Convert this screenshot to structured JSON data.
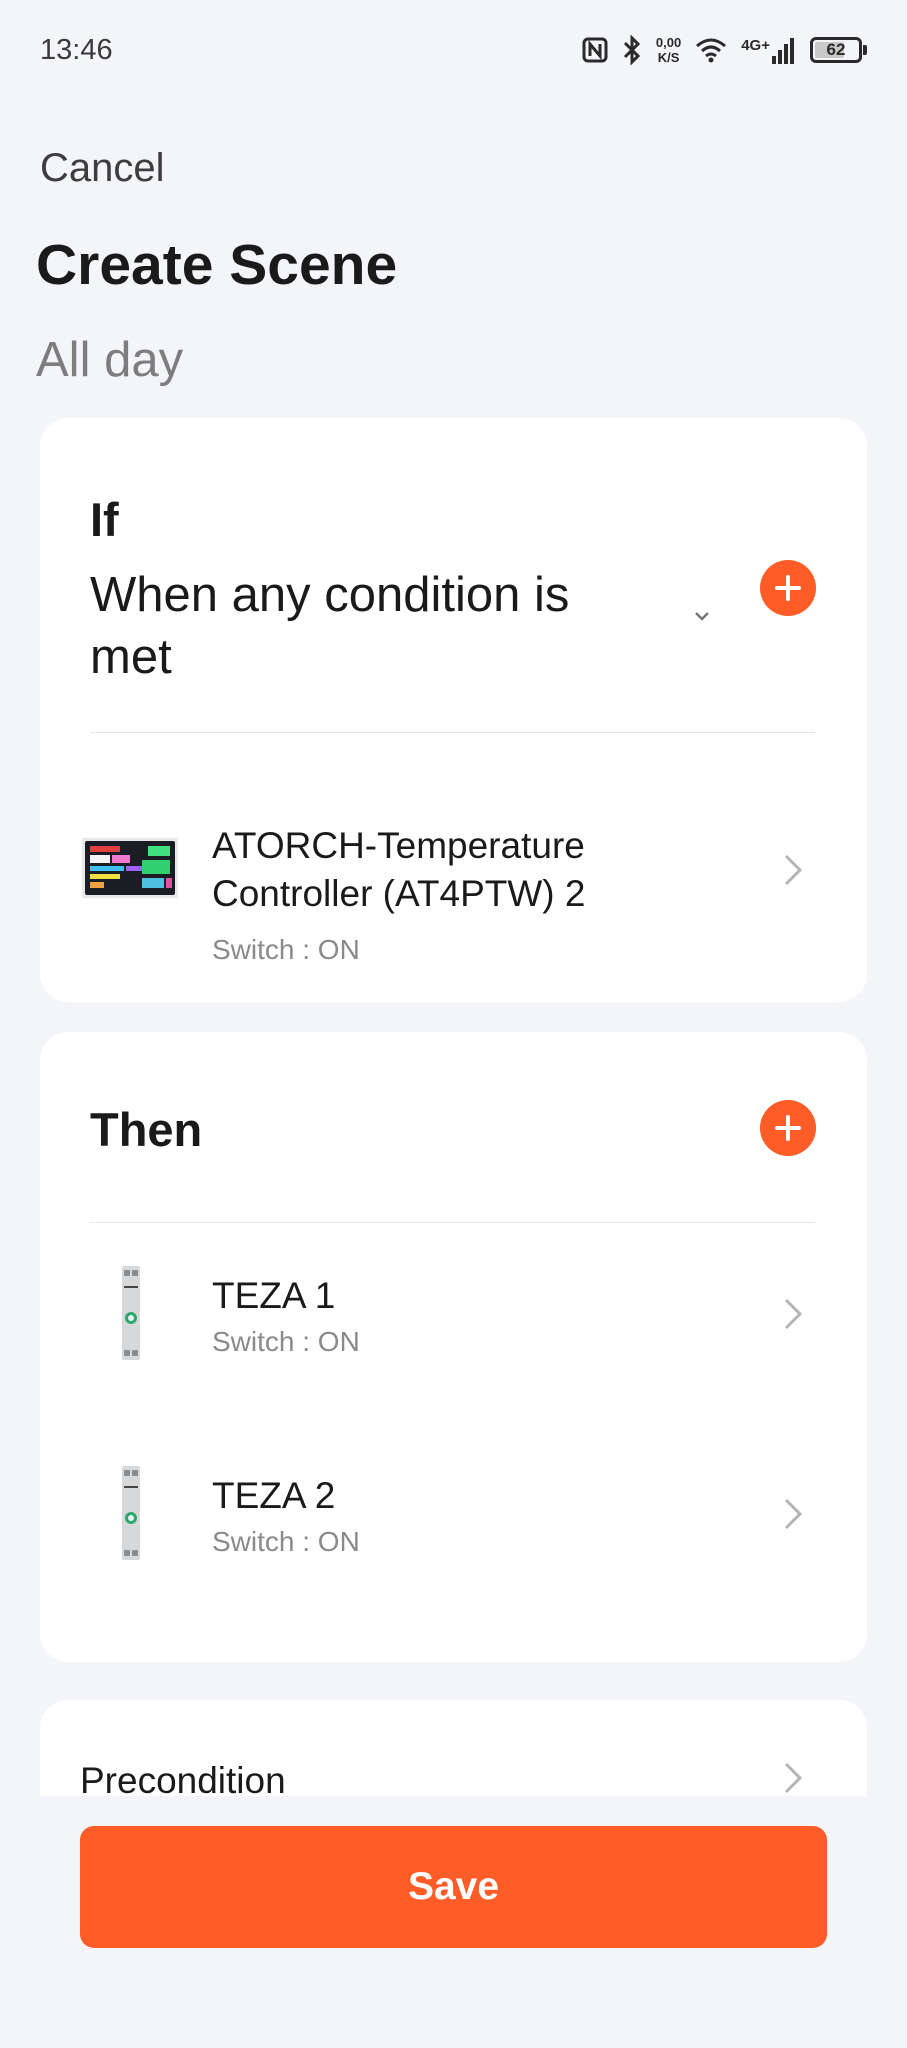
{
  "status_bar": {
    "time": "13:46",
    "net_speed_value": "0,00",
    "net_speed_unit": "K/S",
    "network_type": "4G+",
    "battery_percent": "62",
    "icons": [
      "nfc-icon",
      "bluetooth-icon",
      "wifi-icon",
      "signal-icon",
      "battery-icon"
    ]
  },
  "header": {
    "cancel_label": "Cancel",
    "title": "Create Scene",
    "subtitle": "All day"
  },
  "if_card": {
    "label": "If",
    "condition": "When any condition is met",
    "conditions": [
      {
        "title": "ATORCH-Temperature Controller (AT4PTW) 2",
        "status": "Switch : ON",
        "thumb_icon": "temperature-controller-thumbnail"
      }
    ]
  },
  "then_card": {
    "label": "Then",
    "actions": [
      {
        "title": "TEZA 1",
        "status": "Switch : ON",
        "thumb_icon": "din-switch-thumbnail"
      },
      {
        "title": "TEZA 2",
        "status": "Switch : ON",
        "thumb_icon": "din-switch-thumbnail"
      }
    ]
  },
  "precondition": {
    "label": "Precondition"
  },
  "footer": {
    "save_label": "Save"
  },
  "colors": {
    "accent": "#ff5c28",
    "background": "#f4f5f9",
    "card": "#ffffff",
    "secondary_text": "#8a8a8a"
  }
}
